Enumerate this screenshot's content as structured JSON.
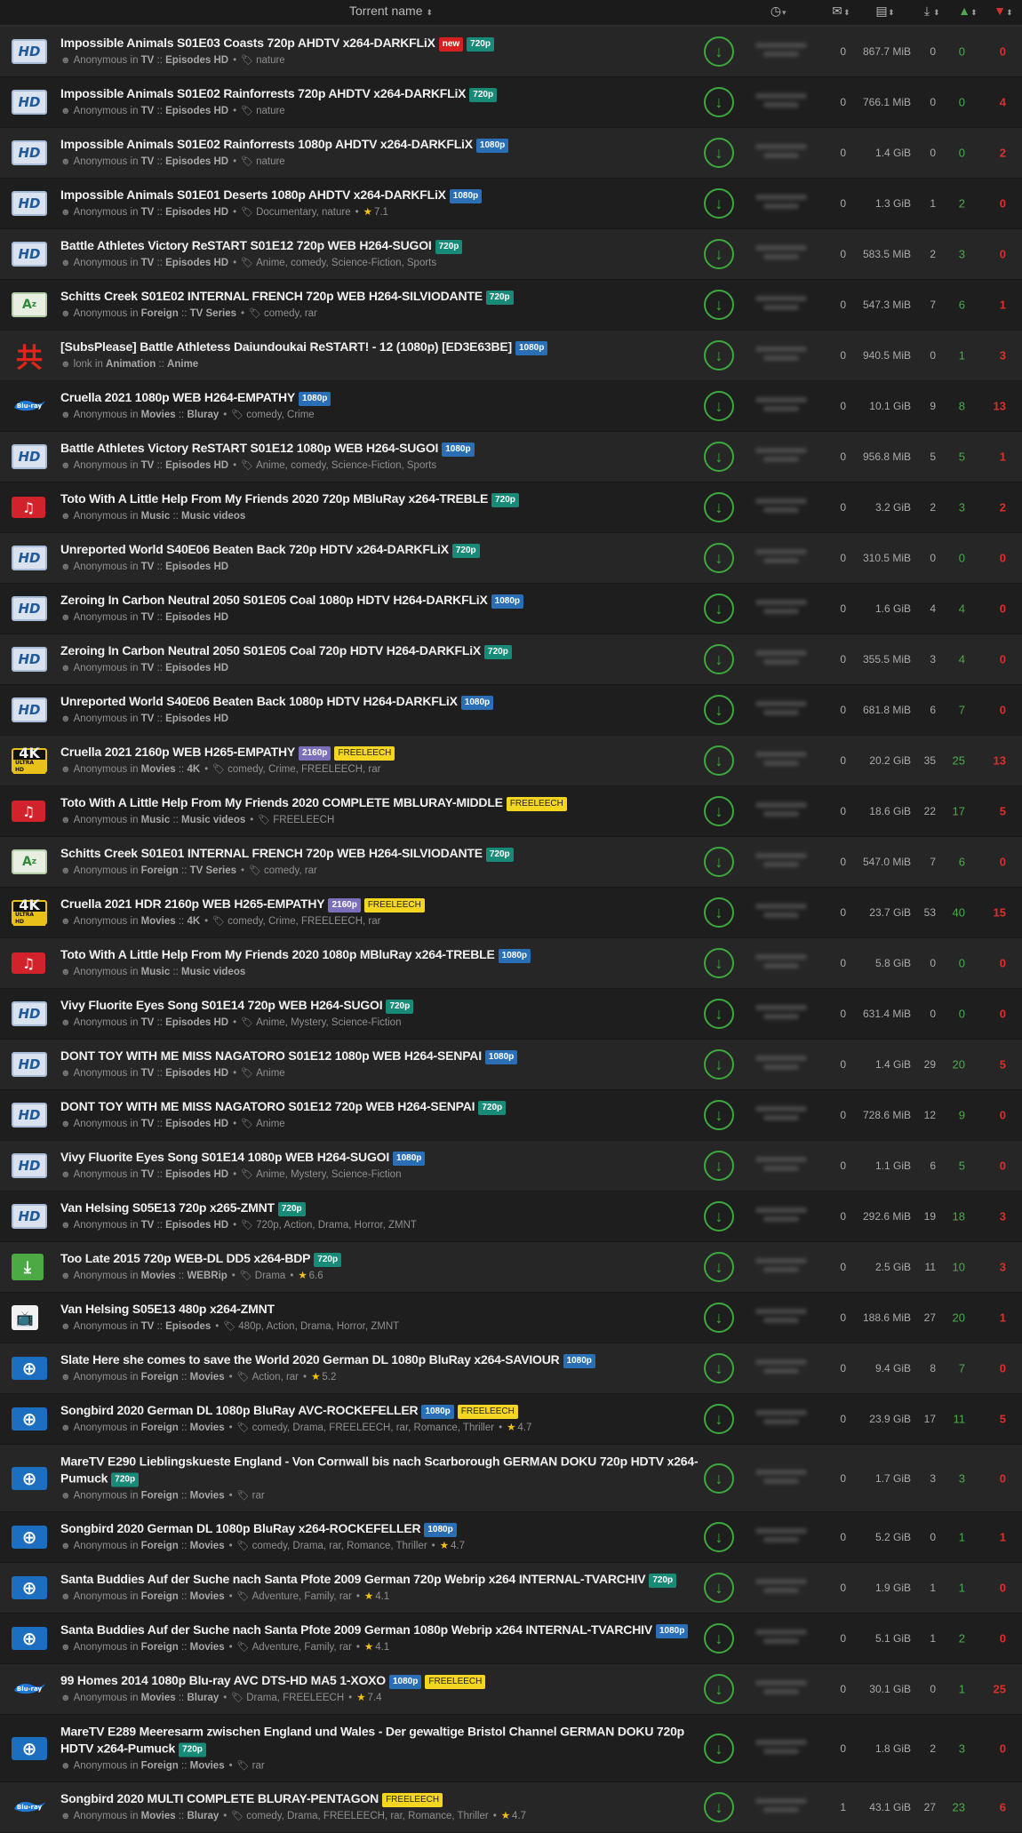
{
  "header": {
    "torrent_name": "Torrent name",
    "sort_glyph": "⬍",
    "col_icons": {
      "time": "clock-icon",
      "comments": "comments-icon",
      "size": "file-size-icon",
      "completed": "download-count-icon",
      "seeders": "seeders-up-icon",
      "leechers": "leechers-down-icon"
    }
  },
  "colors": {
    "seeders": "#4ea84e",
    "leechers": "#d9302b",
    "badge_720p": "#178b77",
    "badge_1080p": "#2a6fb6",
    "badge_2160p": "#7a6fb8",
    "badge_freeleech": "#f4d51f",
    "badge_new": "#d32020"
  },
  "rows": [
    {
      "cat": "hd",
      "title": "Impossible Animals S01E03 Coasts 720p AHDTV x264-DARKFLiX",
      "badges": [
        "new",
        "720p"
      ],
      "user": "Anonymous",
      "catA": "TV",
      "catB": "Episodes HD",
      "tags": "nature",
      "rating": "",
      "cmt": "0",
      "size": "867.7 MiB",
      "cmp": "0",
      "seed": "0",
      "leech": "0"
    },
    {
      "cat": "hd",
      "title": "Impossible Animals S01E02 Rainforrests 720p AHDTV x264-DARKFLiX",
      "badges": [
        "720p"
      ],
      "user": "Anonymous",
      "catA": "TV",
      "catB": "Episodes HD",
      "tags": "nature",
      "rating": "",
      "cmt": "0",
      "size": "766.1 MiB",
      "cmp": "0",
      "seed": "0",
      "leech": "4"
    },
    {
      "cat": "hd",
      "title": "Impossible Animals S01E02 Rainforrests 1080p AHDTV x264-DARKFLiX",
      "badges": [
        "1080p"
      ],
      "user": "Anonymous",
      "catA": "TV",
      "catB": "Episodes HD",
      "tags": "nature",
      "rating": "",
      "cmt": "0",
      "size": "1.4 GiB",
      "cmp": "0",
      "seed": "0",
      "leech": "2"
    },
    {
      "cat": "hd",
      "title": "Impossible Animals S01E01 Deserts 1080p AHDTV x264-DARKFLiX",
      "badges": [
        "1080p"
      ],
      "user": "Anonymous",
      "catA": "TV",
      "catB": "Episodes HD",
      "tags": "Documentary, nature",
      "rating": "7.1",
      "cmt": "0",
      "size": "1.3 GiB",
      "cmp": "1",
      "seed": "2",
      "leech": "0"
    },
    {
      "cat": "hd",
      "title": "Battle Athletes Victory ReSTART S01E12 720p WEB H264-SUGOI",
      "badges": [
        "720p"
      ],
      "user": "Anonymous",
      "catA": "TV",
      "catB": "Episodes HD",
      "tags": "Anime, comedy, Science-Fiction, Sports",
      "rating": "",
      "cmt": "0",
      "size": "583.5 MiB",
      "cmp": "2",
      "seed": "3",
      "leech": "0"
    },
    {
      "cat": "az",
      "title": "Schitts Creek S01E02 INTERNAL FRENCH 720p WEB H264-SILVIODANTE",
      "badges": [
        "720p"
      ],
      "user": "Anonymous",
      "catA": "Foreign",
      "catB": "TV Series",
      "tags": "comedy, rar",
      "rating": "",
      "cmt": "0",
      "size": "547.3 MiB",
      "cmp": "7",
      "seed": "6",
      "leech": "1"
    },
    {
      "cat": "anime",
      "title": "[SubsPlease] Battle Athletess Daiundoukai ReSTART! - 12 (1080p) [ED3E63BE]",
      "badges": [
        "1080p"
      ],
      "user": "lonk",
      "catA": "Animation",
      "catB": "Anime",
      "tags": "",
      "rating": "",
      "cmt": "0",
      "size": "940.5 MiB",
      "cmp": "0",
      "seed": "1",
      "leech": "3"
    },
    {
      "cat": "bluray",
      "title": "Cruella 2021 1080p WEB H264-EMPATHY",
      "badges": [
        "1080p"
      ],
      "user": "Anonymous",
      "catA": "Movies",
      "catB": "Bluray",
      "tags": "comedy, Crime",
      "rating": "",
      "cmt": "0",
      "size": "10.1 GiB",
      "cmp": "9",
      "seed": "8",
      "leech": "13"
    },
    {
      "cat": "hd",
      "title": "Battle Athletes Victory ReSTART S01E12 1080p WEB H264-SUGOI",
      "badges": [
        "1080p"
      ],
      "user": "Anonymous",
      "catA": "TV",
      "catB": "Episodes HD",
      "tags": "Anime, comedy, Science-Fiction, Sports",
      "rating": "",
      "cmt": "0",
      "size": "956.8 MiB",
      "cmp": "5",
      "seed": "5",
      "leech": "1"
    },
    {
      "cat": "music",
      "title": "Toto With A Little Help From My Friends 2020 720p MBluRay x264-TREBLE",
      "badges": [
        "720p"
      ],
      "user": "Anonymous",
      "catA": "Music",
      "catB": "Music videos",
      "tags": "",
      "rating": "",
      "cmt": "0",
      "size": "3.2 GiB",
      "cmp": "2",
      "seed": "3",
      "leech": "2"
    },
    {
      "cat": "hd",
      "title": "Unreported World S40E06 Beaten Back 720p HDTV x264-DARKFLiX",
      "badges": [
        "720p"
      ],
      "user": "Anonymous",
      "catA": "TV",
      "catB": "Episodes HD",
      "tags": "",
      "rating": "",
      "cmt": "0",
      "size": "310.5 MiB",
      "cmp": "0",
      "seed": "0",
      "leech": "0"
    },
    {
      "cat": "hd",
      "title": "Zeroing In Carbon Neutral 2050 S01E05 Coal 1080p HDTV H264-DARKFLiX",
      "badges": [
        "1080p"
      ],
      "user": "Anonymous",
      "catA": "TV",
      "catB": "Episodes HD",
      "tags": "",
      "rating": "",
      "cmt": "0",
      "size": "1.6 GiB",
      "cmp": "4",
      "seed": "4",
      "leech": "0"
    },
    {
      "cat": "hd",
      "title": "Zeroing In Carbon Neutral 2050 S01E05 Coal 720p HDTV H264-DARKFLiX",
      "badges": [
        "720p"
      ],
      "user": "Anonymous",
      "catA": "TV",
      "catB": "Episodes HD",
      "tags": "",
      "rating": "",
      "cmt": "0",
      "size": "355.5 MiB",
      "cmp": "3",
      "seed": "4",
      "leech": "0"
    },
    {
      "cat": "hd",
      "title": "Unreported World S40E06 Beaten Back 1080p HDTV H264-DARKFLiX",
      "badges": [
        "1080p"
      ],
      "user": "Anonymous",
      "catA": "TV",
      "catB": "Episodes HD",
      "tags": "",
      "rating": "",
      "cmt": "0",
      "size": "681.8 MiB",
      "cmp": "6",
      "seed": "7",
      "leech": "0"
    },
    {
      "cat": "4k",
      "title": "Cruella 2021 2160p WEB H265-EMPATHY",
      "badges": [
        "2160p",
        "FREELEECH"
      ],
      "user": "Anonymous",
      "catA": "Movies",
      "catB": "4K",
      "tags": "comedy, Crime, FREELEECH, rar",
      "rating": "",
      "cmt": "0",
      "size": "20.2 GiB",
      "cmp": "35",
      "seed": "25",
      "leech": "13"
    },
    {
      "cat": "music",
      "title": "Toto With A Little Help From My Friends 2020 COMPLETE MBLURAY-MIDDLE",
      "badges": [
        "FREELEECH"
      ],
      "user": "Anonymous",
      "catA": "Music",
      "catB": "Music videos",
      "tags": "FREELEECH",
      "rating": "",
      "cmt": "0",
      "size": "18.6 GiB",
      "cmp": "22",
      "seed": "17",
      "leech": "5"
    },
    {
      "cat": "az",
      "title": "Schitts Creek S01E01 INTERNAL FRENCH 720p WEB H264-SILVIODANTE",
      "badges": [
        "720p"
      ],
      "user": "Anonymous",
      "catA": "Foreign",
      "catB": "TV Series",
      "tags": "comedy, rar",
      "rating": "",
      "cmt": "0",
      "size": "547.0 MiB",
      "cmp": "7",
      "seed": "6",
      "leech": "0"
    },
    {
      "cat": "4k",
      "title": "Cruella 2021 HDR 2160p WEB H265-EMPATHY",
      "badges": [
        "2160p",
        "FREELEECH"
      ],
      "user": "Anonymous",
      "catA": "Movies",
      "catB": "4K",
      "tags": "comedy, Crime, FREELEECH, rar",
      "rating": "",
      "cmt": "0",
      "size": "23.7 GiB",
      "cmp": "53",
      "seed": "40",
      "leech": "15"
    },
    {
      "cat": "music",
      "title": "Toto With A Little Help From My Friends 2020 1080p MBluRay x264-TREBLE",
      "badges": [
        "1080p"
      ],
      "user": "Anonymous",
      "catA": "Music",
      "catB": "Music videos",
      "tags": "",
      "rating": "",
      "cmt": "0",
      "size": "5.8 GiB",
      "cmp": "0",
      "seed": "0",
      "leech": "0"
    },
    {
      "cat": "hd",
      "title": "Vivy Fluorite Eyes Song S01E14 720p WEB H264-SUGOI",
      "badges": [
        "720p"
      ],
      "user": "Anonymous",
      "catA": "TV",
      "catB": "Episodes HD",
      "tags": "Anime, Mystery, Science-Fiction",
      "rating": "",
      "cmt": "0",
      "size": "631.4 MiB",
      "cmp": "0",
      "seed": "0",
      "leech": "0"
    },
    {
      "cat": "hd",
      "title": "DONT TOY WITH ME MISS NAGATORO S01E12 1080p WEB H264-SENPAI",
      "badges": [
        "1080p"
      ],
      "user": "Anonymous",
      "catA": "TV",
      "catB": "Episodes HD",
      "tags": "Anime",
      "rating": "",
      "cmt": "0",
      "size": "1.4 GiB",
      "cmp": "29",
      "seed": "20",
      "leech": "5"
    },
    {
      "cat": "hd",
      "title": "DONT TOY WITH ME MISS NAGATORO S01E12 720p WEB H264-SENPAI",
      "badges": [
        "720p"
      ],
      "user": "Anonymous",
      "catA": "TV",
      "catB": "Episodes HD",
      "tags": "Anime",
      "rating": "",
      "cmt": "0",
      "size": "728.6 MiB",
      "cmp": "12",
      "seed": "9",
      "leech": "0"
    },
    {
      "cat": "hd",
      "title": "Vivy Fluorite Eyes Song S01E14 1080p WEB H264-SUGOI",
      "badges": [
        "1080p"
      ],
      "user": "Anonymous",
      "catA": "TV",
      "catB": "Episodes HD",
      "tags": "Anime, Mystery, Science-Fiction",
      "rating": "",
      "cmt": "0",
      "size": "1.1 GiB",
      "cmp": "6",
      "seed": "5",
      "leech": "0"
    },
    {
      "cat": "hd",
      "title": "Van Helsing S05E13 720p x265-ZMNT",
      "badges": [
        "720p"
      ],
      "user": "Anonymous",
      "catA": "TV",
      "catB": "Episodes HD",
      "tags": "720p, Action, Drama, Horror, ZMNT",
      "rating": "",
      "cmt": "0",
      "size": "292.6 MiB",
      "cmp": "19",
      "seed": "18",
      "leech": "3"
    },
    {
      "cat": "webrip",
      "title": "Too Late 2015 720p WEB-DL DD5 x264-BDP",
      "badges": [
        "720p"
      ],
      "user": "Anonymous",
      "catA": "Movies",
      "catB": "WEBRip",
      "tags": "Drama",
      "rating": "6.6",
      "cmt": "0",
      "size": "2.5 GiB",
      "cmp": "11",
      "seed": "10",
      "leech": "3"
    },
    {
      "cat": "tv",
      "title": "Van Helsing S05E13 480p x264-ZMNT",
      "badges": [],
      "user": "Anonymous",
      "catA": "TV",
      "catB": "Episodes",
      "tags": "480p, Action, Drama, Horror, ZMNT",
      "rating": "",
      "cmt": "0",
      "size": "188.6 MiB",
      "cmp": "27",
      "seed": "20",
      "leech": "1"
    },
    {
      "cat": "globe",
      "title": "Slate Here she comes to save the World 2020 German DL 1080p BluRay x264-SAVIOUR",
      "badges": [
        "1080p"
      ],
      "user": "Anonymous",
      "catA": "Foreign",
      "catB": "Movies",
      "tags": "Action, rar",
      "rating": "5.2",
      "cmt": "0",
      "size": "9.4 GiB",
      "cmp": "8",
      "seed": "7",
      "leech": "0"
    },
    {
      "cat": "globe",
      "title": "Songbird 2020 German DL 1080p BluRay AVC-ROCKEFELLER",
      "badges": [
        "1080p",
        "FREELEECH"
      ],
      "user": "Anonymous",
      "catA": "Foreign",
      "catB": "Movies",
      "tags": "comedy, Drama, FREELEECH, rar, Romance, Thriller",
      "rating": "4.7",
      "cmt": "0",
      "size": "23.9 GiB",
      "cmp": "17",
      "seed": "11",
      "leech": "5"
    },
    {
      "cat": "globe",
      "tall": true,
      "title": "MareTV E290 Lieblingskueste England - Von Cornwall bis nach Scarborough GERMAN DOKU 720p HDTV x264-Pumuck",
      "badges": [
        "720p"
      ],
      "user": "Anonymous",
      "catA": "Foreign",
      "catB": "Movies",
      "tags": "rar",
      "rating": "",
      "cmt": "0",
      "size": "1.7 GiB",
      "cmp": "3",
      "seed": "3",
      "leech": "0"
    },
    {
      "cat": "globe",
      "title": "Songbird 2020 German DL 1080p BluRay x264-ROCKEFELLER",
      "badges": [
        "1080p"
      ],
      "user": "Anonymous",
      "catA": "Foreign",
      "catB": "Movies",
      "tags": "comedy, Drama, rar, Romance, Thriller",
      "rating": "4.7",
      "cmt": "0",
      "size": "5.2 GiB",
      "cmp": "0",
      "seed": "1",
      "leech": "1"
    },
    {
      "cat": "globe",
      "title": "Santa Buddies Auf der Suche nach Santa Pfote 2009 German 720p Webrip x264 INTERNAL-TVARCHIV",
      "badges": [
        "720p"
      ],
      "user": "Anonymous",
      "catA": "Foreign",
      "catB": "Movies",
      "tags": "Adventure, Family, rar",
      "rating": "4.1",
      "cmt": "0",
      "size": "1.9 GiB",
      "cmp": "1",
      "seed": "1",
      "leech": "0"
    },
    {
      "cat": "globe",
      "title": "Santa Buddies Auf der Suche nach Santa Pfote 2009 German 1080p Webrip x264 INTERNAL-TVARCHIV",
      "badges": [
        "1080p"
      ],
      "user": "Anonymous",
      "catA": "Foreign",
      "catB": "Movies",
      "tags": "Adventure, Family, rar",
      "rating": "4.1",
      "cmt": "0",
      "size": "5.1 GiB",
      "cmp": "1",
      "seed": "2",
      "leech": "0"
    },
    {
      "cat": "bluray",
      "title": "99 Homes 2014 1080p Blu-ray AVC DTS-HD MA5 1-XOXO",
      "badges": [
        "1080p",
        "FREELEECH"
      ],
      "user": "Anonymous",
      "catA": "Movies",
      "catB": "Bluray",
      "tags": "Drama, FREELEECH",
      "rating": "7.4",
      "cmt": "0",
      "size": "30.1 GiB",
      "cmp": "0",
      "seed": "1",
      "leech": "25"
    },
    {
      "cat": "globe",
      "tall": true,
      "title": "MareTV E289 Meeresarm zwischen England und Wales - Der gewaltige Bristol Channel GERMAN DOKU 720p HDTV x264-Pumuck",
      "badges": [
        "720p"
      ],
      "user": "Anonymous",
      "catA": "Foreign",
      "catB": "Movies",
      "tags": "rar",
      "rating": "",
      "cmt": "0",
      "size": "1.8 GiB",
      "cmp": "2",
      "seed": "3",
      "leech": "0"
    },
    {
      "cat": "bluray",
      "title": "Songbird 2020 MULTI COMPLETE BLURAY-PENTAGON",
      "badges": [
        "FREELEECH"
      ],
      "user": "Anonymous",
      "catA": "Movies",
      "catB": "Bluray",
      "tags": "comedy, Drama, FREELEECH, rar, Romance, Thriller",
      "rating": "4.7",
      "cmt": "1",
      "size": "43.1 GiB",
      "cmp": "27",
      "seed": "23",
      "leech": "6"
    }
  ],
  "labels": {
    "in": "in",
    "sep": "::"
  }
}
